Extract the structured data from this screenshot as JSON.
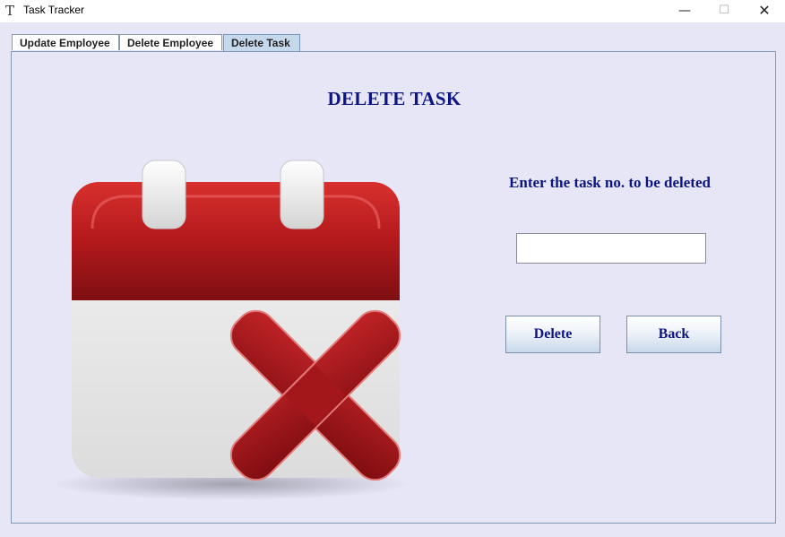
{
  "window": {
    "title": "Task Tracker",
    "app_icon": "T",
    "controls": {
      "minimize": "—",
      "maximize": "☐",
      "close": "✕"
    }
  },
  "tabs": [
    {
      "label": "Update Employee",
      "selected": false
    },
    {
      "label": "Delete Employee",
      "selected": false
    },
    {
      "label": "Delete Task",
      "selected": true
    }
  ],
  "main": {
    "heading": "DELETE TASK",
    "prompt": "Enter the task no. to be deleted",
    "task_input": {
      "value": "",
      "placeholder": ""
    },
    "delete_button": "Delete",
    "back_button": "Back",
    "illustration_icon": "calendar-delete-icon"
  },
  "colors": {
    "text_accent": "#0d1585",
    "background": "#e6e6f7",
    "calendar_red": "#b3191c",
    "cross_red": "#a8151a"
  }
}
